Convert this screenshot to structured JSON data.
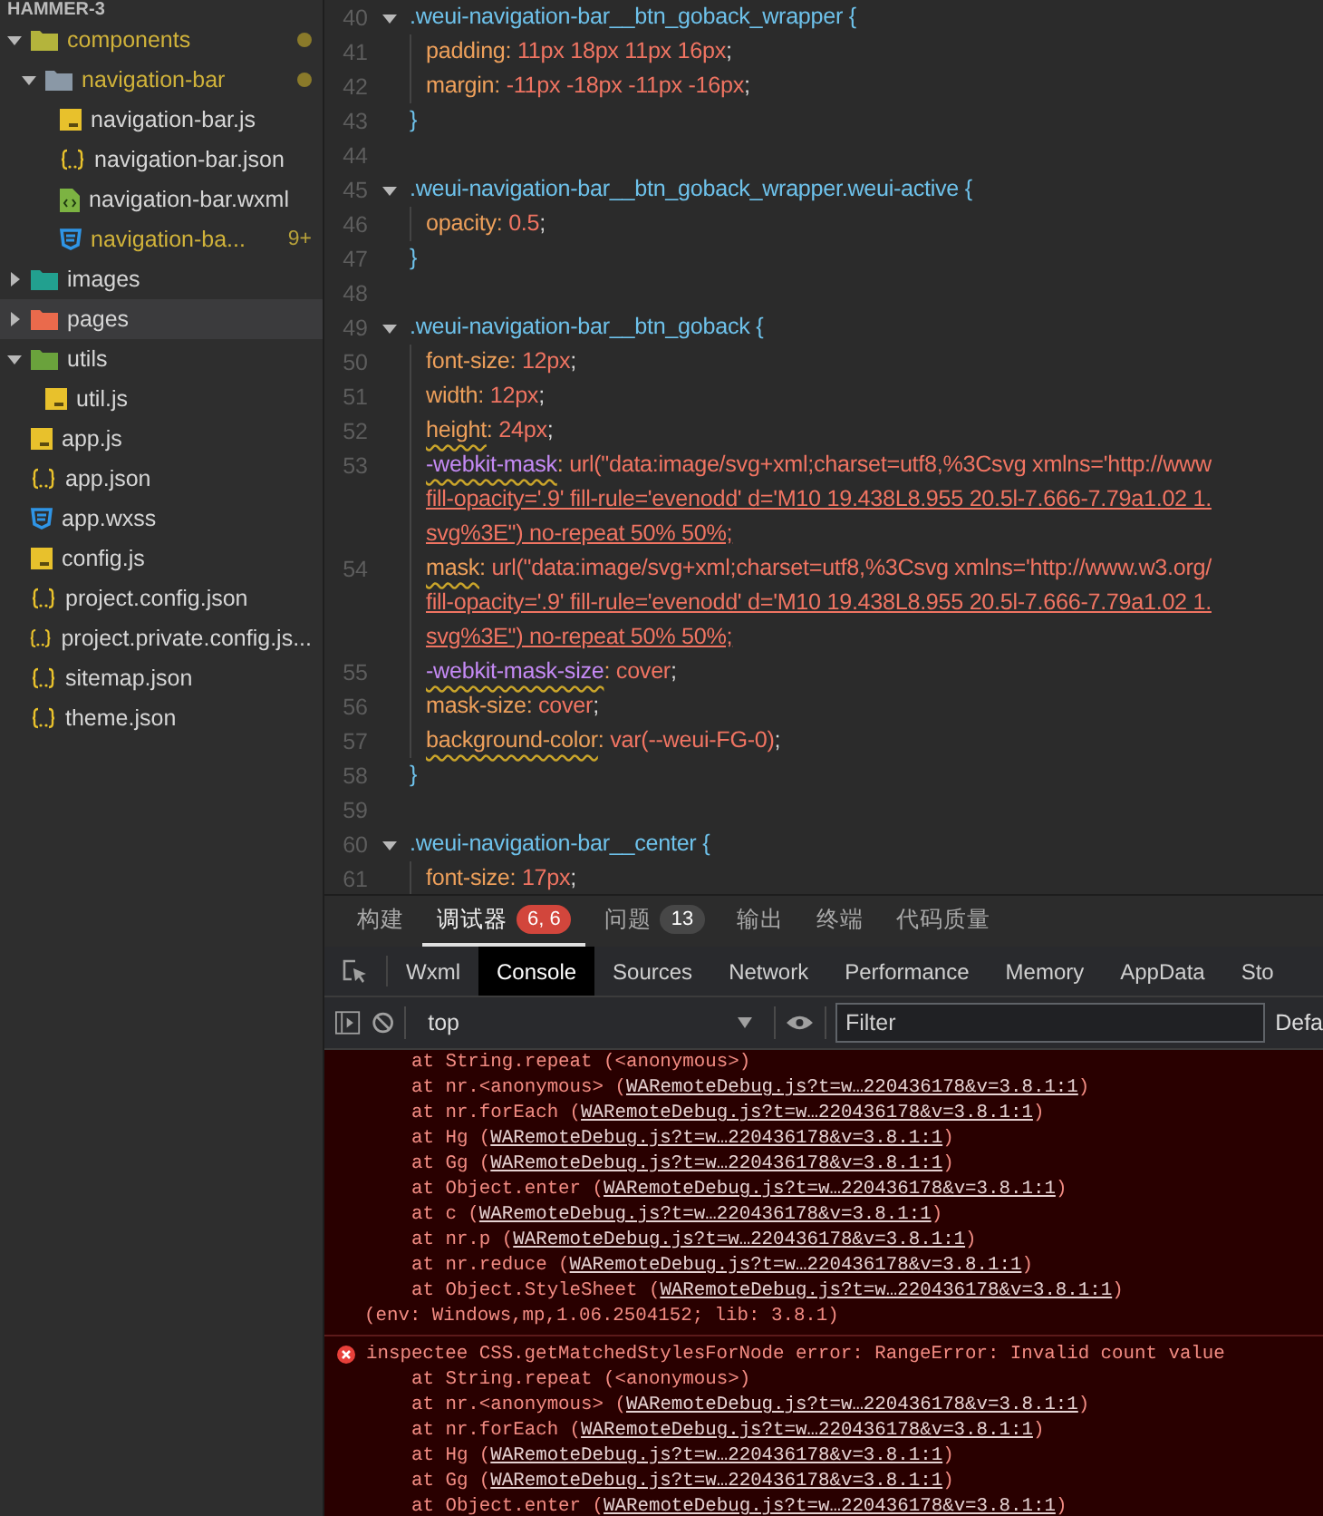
{
  "sidebar": {
    "project_title": "HAMMER-3",
    "tree": [
      {
        "name": "components",
        "kind": "folder",
        "color": "#b4b43c",
        "expanded": true,
        "selected": false,
        "modified": true,
        "children": [
          {
            "name": "navigation-bar",
            "kind": "folder",
            "color": "#8a98a6",
            "expanded": true,
            "selected": false,
            "modified": true,
            "children": [
              {
                "name": "navigation-bar.js",
                "kind": "js",
                "selected": false,
                "modified": false
              },
              {
                "name": "navigation-bar.json",
                "kind": "json",
                "selected": false,
                "modified": false
              },
              {
                "name": "navigation-bar.wxml",
                "kind": "wxml",
                "selected": false,
                "modified": false
              },
              {
                "name": "navigation-ba...",
                "kind": "wxss",
                "selected": false,
                "modified": true,
                "badge": "9+"
              }
            ]
          }
        ]
      },
      {
        "name": "images",
        "kind": "folder",
        "color": "#22a08f",
        "expanded": false,
        "selected": false,
        "modified": false
      },
      {
        "name": "pages",
        "kind": "folder",
        "color": "#ea6a4c",
        "expanded": false,
        "selected": true,
        "modified": false
      },
      {
        "name": "utils",
        "kind": "folder",
        "color": "#6aa23c",
        "expanded": true,
        "selected": false,
        "modified": false,
        "children": [
          {
            "name": "util.js",
            "kind": "js",
            "selected": false,
            "modified": false
          }
        ]
      },
      {
        "name": "app.js",
        "kind": "js",
        "selected": false,
        "modified": false
      },
      {
        "name": "app.json",
        "kind": "json",
        "selected": false,
        "modified": false
      },
      {
        "name": "app.wxss",
        "kind": "wxss",
        "selected": false,
        "modified": false
      },
      {
        "name": "config.js",
        "kind": "js",
        "selected": false,
        "modified": false
      },
      {
        "name": "project.config.json",
        "kind": "json",
        "selected": false,
        "modified": false
      },
      {
        "name": "project.private.config.js...",
        "kind": "json",
        "selected": false,
        "modified": false
      },
      {
        "name": "sitemap.json",
        "kind": "json",
        "selected": false,
        "modified": false
      },
      {
        "name": "theme.json",
        "kind": "json",
        "selected": false,
        "modified": false
      }
    ]
  },
  "editor": {
    "lines": [
      {
        "number": "40",
        "kind": "selector",
        "expanded": true,
        "text": ".weui-navigation-bar__btn_goback_wrapper {"
      },
      {
        "number": "41",
        "kind": "declaration",
        "warning": false,
        "text": "padding: 11px 18px 11px 16px;"
      },
      {
        "number": "42",
        "kind": "declaration",
        "warning": false,
        "text": "margin: -11px -18px -11px -16px;"
      },
      {
        "number": "43",
        "kind": "close",
        "text": "}"
      },
      {
        "number": "44",
        "kind": "blank"
      },
      {
        "number": "45",
        "kind": "selector",
        "expanded": true,
        "text": ".weui-navigation-bar__btn_goback_wrapper.weui-active {"
      },
      {
        "number": "46",
        "kind": "declaration",
        "warning": false,
        "text": "opacity: 0.5;"
      },
      {
        "number": "47",
        "kind": "close",
        "text": "}"
      },
      {
        "number": "48",
        "kind": "blank"
      },
      {
        "number": "49",
        "kind": "selector",
        "expanded": true,
        "text": ".weui-navigation-bar__btn_goback {"
      },
      {
        "number": "50",
        "kind": "declaration",
        "warning": false,
        "text": "font-size: 12px;"
      },
      {
        "number": "51",
        "kind": "declaration",
        "warning": false,
        "text": "width: 12px;"
      },
      {
        "number": "52",
        "kind": "declaration",
        "warning": true,
        "text": "height: 24px;"
      },
      {
        "number": "53",
        "kind": "declaration",
        "warning": true,
        "text": "-webkit-mask: url(\"data:image/svg+xml;charset=utf8,%3Csvg xmlns='http://www"
      },
      {
        "kind": "wrap",
        "text": "fill-opacity='.9' fill-rule='evenodd' d='M10 19.438L8.955 20.5l-7.666-7.79a1.02 1."
      },
      {
        "kind": "wrap",
        "text": "svg%3E\") no-repeat 50% 50%;"
      },
      {
        "number": "54",
        "kind": "declaration",
        "warning": true,
        "text": "mask: url(\"data:image/svg+xml;charset=utf8,%3Csvg xmlns='http://www.w3.org/"
      },
      {
        "kind": "wrap",
        "text": "fill-opacity='.9' fill-rule='evenodd' d='M10 19.438L8.955 20.5l-7.666-7.79a1.02 1."
      },
      {
        "kind": "wrap",
        "text": "svg%3E\") no-repeat 50% 50%;"
      },
      {
        "number": "55",
        "kind": "declaration",
        "warning": true,
        "text": "-webkit-mask-size: cover;"
      },
      {
        "number": "56",
        "kind": "declaration",
        "warning": false,
        "text": "mask-size: cover;"
      },
      {
        "number": "57",
        "kind": "declaration",
        "warning": true,
        "text": "background-color: var(--weui-FG-0);"
      },
      {
        "number": "58",
        "kind": "close",
        "text": "}"
      },
      {
        "number": "59",
        "kind": "blank"
      },
      {
        "number": "60",
        "kind": "selector",
        "expanded": true,
        "text": ".weui-navigation-bar__center {"
      },
      {
        "number": "61",
        "kind": "declaration",
        "warning": false,
        "text": "font-size: 17px;"
      }
    ]
  },
  "panel": {
    "tabs": [
      {
        "label": "构建",
        "selected": false
      },
      {
        "label": "调试器",
        "selected": true,
        "badge": "6, 6",
        "color": "#d2463c"
      },
      {
        "label": "问题",
        "selected": false,
        "badge": "13",
        "color": "#474747"
      },
      {
        "label": "输出",
        "selected": false
      },
      {
        "label": "终端",
        "selected": false
      },
      {
        "label": "代码质量",
        "selected": false
      }
    ]
  },
  "devtools": {
    "tabs": [
      {
        "label": "Wxml",
        "selected": false
      },
      {
        "label": "Console",
        "selected": true
      },
      {
        "label": "Sources",
        "selected": false
      },
      {
        "label": "Network",
        "selected": false
      },
      {
        "label": "Performance",
        "selected": false
      },
      {
        "label": "Memory",
        "selected": false
      },
      {
        "label": "AppData",
        "selected": false
      },
      {
        "label": "Sto",
        "selected": false
      }
    ],
    "context": "top",
    "filter": {
      "placeholder": "Filter"
    },
    "levels": "Defa"
  },
  "console": {
    "messages": [
      {
        "kind": "error-continued",
        "frames": [
          {
            "prefix": "at String.repeat (<anonymous>)"
          },
          {
            "prefix": "at nr.<anonymous> (",
            "link": "WARemoteDebug.js?t=w…220436178&v=3.8.1:1",
            "suffix": ")"
          },
          {
            "prefix": "at nr.forEach (",
            "link": "WARemoteDebug.js?t=w…220436178&v=3.8.1:1",
            "suffix": ")"
          },
          {
            "prefix": "at Hg (",
            "link": "WARemoteDebug.js?t=w…220436178&v=3.8.1:1",
            "suffix": ")"
          },
          {
            "prefix": "at Gg (",
            "link": "WARemoteDebug.js?t=w…220436178&v=3.8.1:1",
            "suffix": ")"
          },
          {
            "prefix": "at Object.enter (",
            "link": "WARemoteDebug.js?t=w…220436178&v=3.8.1:1",
            "suffix": ")"
          },
          {
            "prefix": "at c (",
            "link": "WARemoteDebug.js?t=w…220436178&v=3.8.1:1",
            "suffix": ")"
          },
          {
            "prefix": "at nr.p (",
            "link": "WARemoteDebug.js?t=w…220436178&v=3.8.1:1",
            "suffix": ")"
          },
          {
            "prefix": "at nr.reduce (",
            "link": "WARemoteDebug.js?t=w…220436178&v=3.8.1:1",
            "suffix": ")"
          },
          {
            "prefix": "at Object.StyleSheet (",
            "link": "WARemoteDebug.js?t=w…220436178&v=3.8.1:1",
            "suffix": ")"
          }
        ],
        "env": "(env: Windows,mp,1.06.2504152; lib: 3.8.1)"
      },
      {
        "kind": "error",
        "text": "inspectee CSS.getMatchedStylesForNode error: RangeError: Invalid count value",
        "frames": [
          {
            "prefix": "at String.repeat (<anonymous>)"
          },
          {
            "prefix": "at nr.<anonymous> (",
            "link": "WARemoteDebug.js?t=w…220436178&v=3.8.1:1",
            "suffix": ")"
          },
          {
            "prefix": "at nr.forEach (",
            "link": "WARemoteDebug.js?t=w…220436178&v=3.8.1:1",
            "suffix": ")"
          },
          {
            "prefix": "at Hg (",
            "link": "WARemoteDebug.js?t=w…220436178&v=3.8.1:1",
            "suffix": ")"
          },
          {
            "prefix": "at Gg (",
            "link": "WARemoteDebug.js?t=w…220436178&v=3.8.1:1",
            "suffix": ")"
          },
          {
            "prefix": "at Object.enter (",
            "link": "WARemoteDebug.js?t=w…220436178&v=3.8.1:1",
            "suffix": ")"
          }
        ]
      }
    ]
  }
}
